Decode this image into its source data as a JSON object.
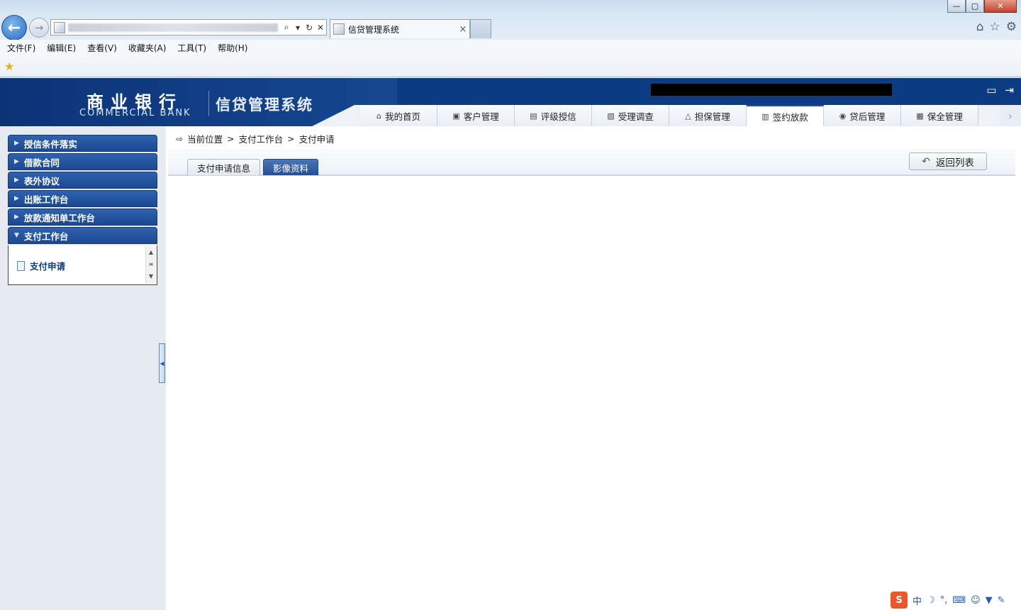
{
  "browser": {
    "tab_title": "信贷管理系统",
    "tab_close": "×",
    "back_glyph": "←",
    "forward_glyph": "→",
    "address_buttons": [
      "⌕",
      "▾",
      "↻",
      "✕"
    ],
    "window_controls": [
      "—",
      "▢",
      "✕"
    ],
    "toolbar_icons": [
      "home-icon",
      "star-icon",
      "gear-icon"
    ],
    "menu": [
      "文件(F)",
      "编辑(E)",
      "查看(V)",
      "收藏夹(A)",
      "工具(T)",
      "帮助(H)"
    ]
  },
  "header": {
    "logo_cn": "商业银行",
    "logo_en": "COMMERCIAL BANK",
    "system_title": "信贷管理系统",
    "brand_color": "#0e3c82"
  },
  "nav": {
    "tabs": [
      {
        "label": "我的首页",
        "icon": "home-icon"
      },
      {
        "label": "客户管理",
        "icon": "customer-icon"
      },
      {
        "label": "评级授信",
        "icon": "rating-icon"
      },
      {
        "label": "受理调查",
        "icon": "survey-icon"
      },
      {
        "label": "担保管理",
        "icon": "guarantee-icon"
      },
      {
        "label": "签约放款",
        "icon": "contract-icon",
        "active": true
      },
      {
        "label": "贷后管理",
        "icon": "postloan-icon"
      },
      {
        "label": "保全管理",
        "icon": "preserve-icon"
      }
    ]
  },
  "sidebar": {
    "groups": [
      {
        "label": "授信条件落实",
        "expanded": false
      },
      {
        "label": "借款合同",
        "expanded": false
      },
      {
        "label": "表外协议",
        "expanded": false
      },
      {
        "label": "出账工作台",
        "expanded": false
      },
      {
        "label": "放款通知单工作台",
        "expanded": false
      },
      {
        "label": "支付工作台",
        "expanded": true
      }
    ],
    "active_item": "支付申请"
  },
  "breadcrumb": {
    "items": [
      "当前位置",
      ">",
      "支付工作台",
      ">",
      "支付申请"
    ]
  },
  "content": {
    "tabs": [
      "支付申请信息",
      "影像资料"
    ],
    "active_tab": "影像资料",
    "back_button": "返回列表"
  },
  "ime": {
    "logo": "S",
    "mode": "中"
  }
}
